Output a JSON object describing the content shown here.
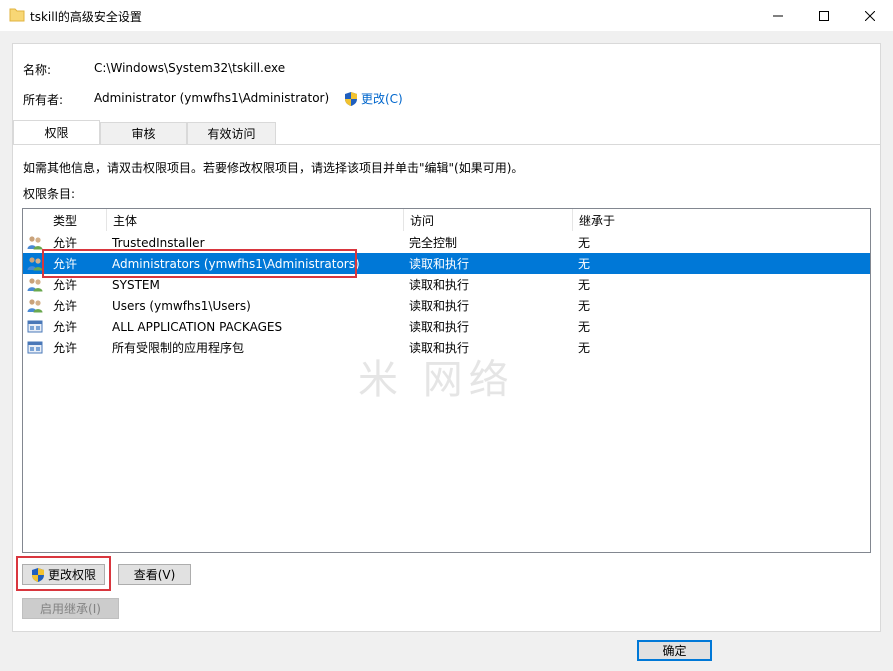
{
  "window": {
    "title": "tskill的高级安全设置",
    "folder_icon": "folder-icon",
    "minimize_icon": "minimize-icon",
    "maximize_icon": "maximize-icon",
    "close_icon": "close-icon"
  },
  "name": {
    "label": "名称:",
    "value": "C:\\Windows\\System32\\tskill.exe"
  },
  "owner": {
    "label": "所有者:",
    "value": "Administrator (ymwfhs1\\Administrator)",
    "change_link": "更改(C)"
  },
  "tabs": [
    {
      "label": "权限",
      "active": true
    },
    {
      "label": "审核",
      "active": false
    },
    {
      "label": "有效访问",
      "active": false
    }
  ],
  "info_text": "如需其他信息，请双击权限项目。若要修改权限项目，请选择该项目并单击\"编辑\"(如果可用)。",
  "entries_label": "权限条目:",
  "table": {
    "columns": [
      "类型",
      "主体",
      "访问",
      "继承于"
    ],
    "rows": [
      {
        "icon": "users-icon",
        "type": "允许",
        "principal": "TrustedInstaller",
        "access": "完全控制",
        "inherited": "无",
        "selected": false
      },
      {
        "icon": "users-icon",
        "type": "允许",
        "principal": "Administrators (ymwfhs1\\Administrators)",
        "access": "读取和执行",
        "inherited": "无",
        "selected": true
      },
      {
        "icon": "users-icon",
        "type": "允许",
        "principal": "SYSTEM",
        "access": "读取和执行",
        "inherited": "无",
        "selected": false
      },
      {
        "icon": "users-icon",
        "type": "允许",
        "principal": "Users (ymwfhs1\\Users)",
        "access": "读取和执行",
        "inherited": "无",
        "selected": false
      },
      {
        "icon": "app-package-icon",
        "type": "允许",
        "principal": "ALL APPLICATION PACKAGES",
        "access": "读取和执行",
        "inherited": "无",
        "selected": false
      },
      {
        "icon": "app-package-icon",
        "type": "允许",
        "principal": "所有受限制的应用程序包",
        "access": "读取和执行",
        "inherited": "无",
        "selected": false
      }
    ]
  },
  "watermark": "米 网络",
  "buttons": {
    "change_permissions": "更改权限",
    "view": "查看(V)",
    "enable_inheritance": "启用继承(I)",
    "ok": "确定"
  },
  "colors": {
    "selection": "#0078d7",
    "link": "#0066cc",
    "highlight": "#d9363e"
  }
}
